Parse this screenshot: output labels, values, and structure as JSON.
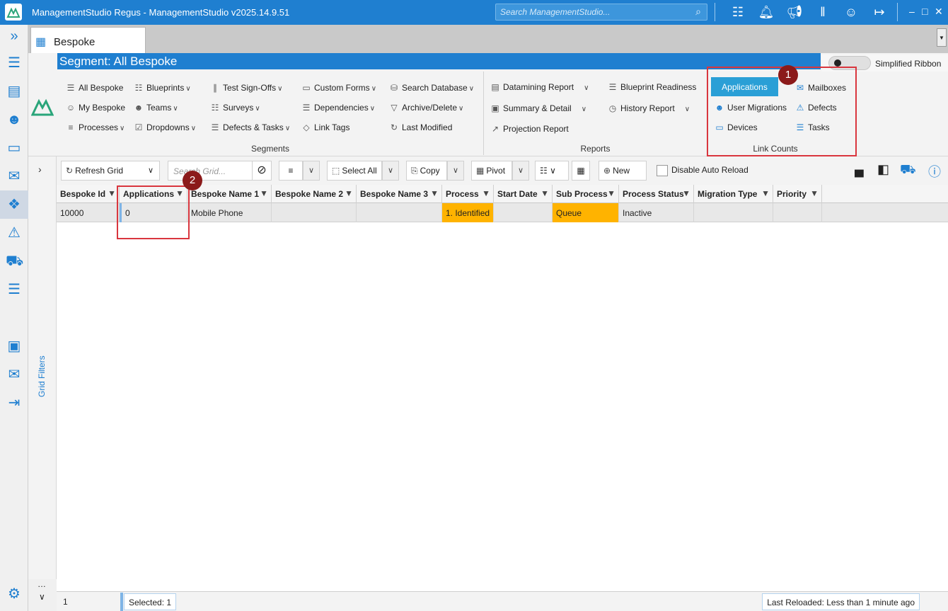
{
  "titlebar": {
    "title": "ManagementStudio Regus - ManagementStudio v2025.14.9.51",
    "search_placeholder": "Search ManagementStudio...",
    "icons": [
      "hierarchy-icon",
      "bell-icon",
      "megaphone-icon",
      "audio-wave-icon",
      "user-icon",
      "logout-icon"
    ],
    "window_controls": [
      "minimize",
      "maximize",
      "close"
    ]
  },
  "leftnav": {
    "expand_icon": "double-chevron-right-icon",
    "icons": [
      "list-icon",
      "calendar-icon",
      "users-icon",
      "monitor-icon",
      "mailbox-icon",
      "apps-icon",
      "warning-icon",
      "truck-icon",
      "tasks-icon",
      "contact-card-icon",
      "mail-migration-icon",
      "import-icon",
      "settings-icon"
    ]
  },
  "tab": {
    "label": "Bespoke"
  },
  "segment_header": "Segment: All Bespoke",
  "simplified_ribbon": "Simplified Ribbon",
  "ribbon": {
    "segments": {
      "label": "Segments",
      "buttons": [
        "All Bespoke",
        "Blueprints",
        "Test Sign-Offs",
        "Custom Forms",
        "Search Database",
        "My Bespoke",
        "Teams",
        "Surveys",
        "Dependencies",
        "Archive/Delete",
        "Processes",
        "Dropdowns",
        "Defects & Tasks",
        "Link Tags",
        "Last Modified"
      ]
    },
    "reports": {
      "label": "Reports",
      "buttons": [
        "Datamining Report",
        "Blueprint Readiness",
        "Summary & Detail",
        "History Report",
        "Projection Report"
      ]
    },
    "link_counts": {
      "label": "Link Counts",
      "buttons": [
        "Applications",
        "Mailboxes",
        "User Migrations",
        "Defects",
        "Devices",
        "Tasks"
      ]
    }
  },
  "callouts": [
    "1",
    "2"
  ],
  "toolbar": {
    "refresh": "Refresh Grid",
    "search_placeholder": "Search Grid...",
    "select_all": "Select All",
    "copy": "Copy",
    "pivot": "Pivot",
    "new": "New",
    "disable_reload": "Disable Auto Reload"
  },
  "grid_filters_label": "Grid Filters",
  "grid": {
    "columns": [
      "Bespoke Id",
      "Applications",
      "Bespoke Name 1",
      "Bespoke Name 2",
      "Bespoke Name 3",
      "Process",
      "Start Date",
      "Sub Process",
      "Process Status",
      "Migration Type",
      "Priority"
    ],
    "rows": [
      [
        "10000",
        "0",
        "Mobile Phone",
        "",
        "",
        "1. Identified",
        "",
        "Queue",
        "Inactive",
        "",
        ""
      ]
    ]
  },
  "status": {
    "count": "1",
    "selected": "Selected: 1",
    "reloaded": "Last Reloaded: Less than 1 minute ago"
  },
  "colors": {
    "brand_blue": "#1f7fd0",
    "highlight_orange": "#ffb300",
    "callout_red": "#d9363e"
  }
}
